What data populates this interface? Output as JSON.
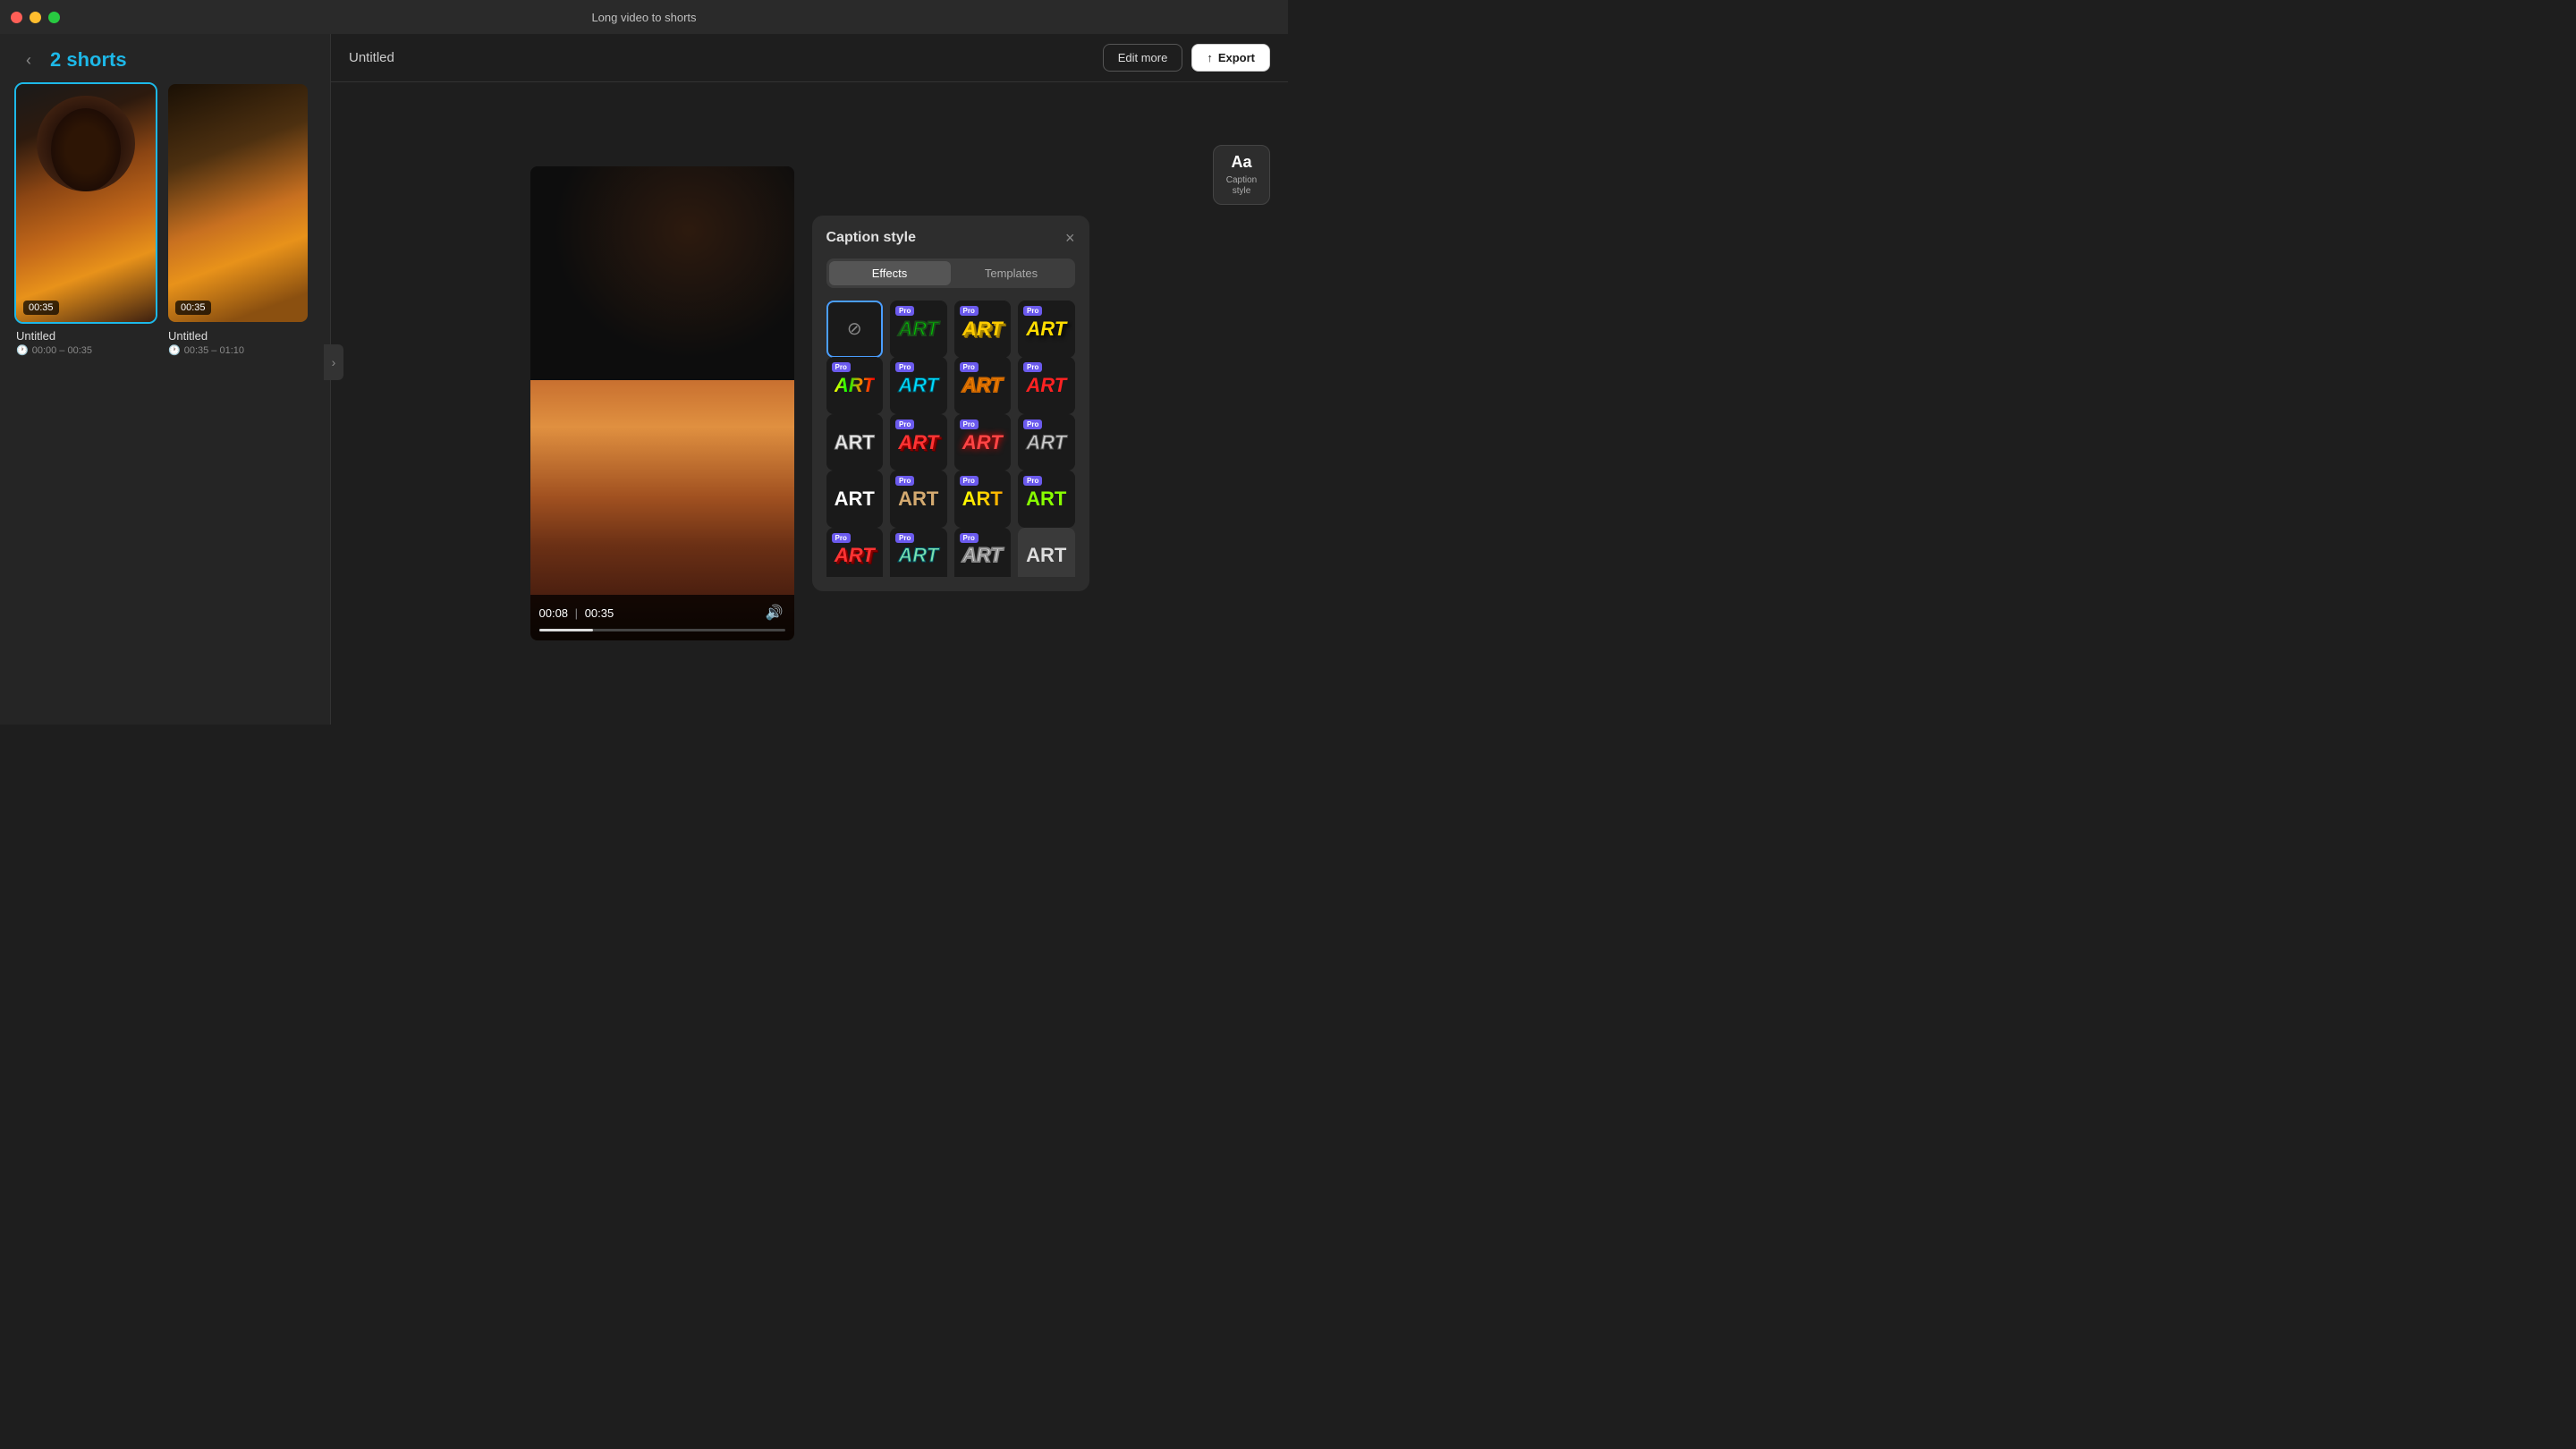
{
  "window": {
    "title": "Long video to shorts"
  },
  "titlebar": {
    "close_label": "close",
    "minimize_label": "minimize",
    "maximize_label": "maximize"
  },
  "left_panel": {
    "back_label": "‹",
    "title": "2 shorts",
    "shorts": [
      {
        "name": "Untitled",
        "duration": "00:35",
        "time_range": "00:00 – 00:35",
        "selected": true
      },
      {
        "name": "Untitled",
        "duration": "00:35",
        "time_range": "00:35 – 01:10",
        "selected": false
      }
    ]
  },
  "top_bar": {
    "doc_title": "Untitled",
    "edit_more_label": "Edit more",
    "export_label": "Export",
    "export_icon": "↑"
  },
  "video": {
    "current_time": "00:08",
    "total_time": "00:35",
    "separator": "|",
    "progress_percent": 22
  },
  "caption_panel": {
    "title": "Caption style",
    "close_label": "×",
    "tabs": [
      {
        "id": "effects",
        "label": "Effects",
        "active": true
      },
      {
        "id": "templates",
        "label": "Templates",
        "active": false
      }
    ],
    "styles": [
      {
        "id": "none",
        "type": "none",
        "bg": "dark",
        "selected": true,
        "pro": false
      },
      {
        "id": "green-italic",
        "text": "ART",
        "type": "green-outline",
        "bg": "dark",
        "selected": false,
        "pro": true
      },
      {
        "id": "yellow-3d",
        "text": "ART",
        "type": "yellow-3d",
        "bg": "dark",
        "selected": false,
        "pro": true
      },
      {
        "id": "yellow-shadow",
        "text": "ART",
        "type": "yellow-shadow",
        "bg": "dark",
        "selected": false,
        "pro": true
      },
      {
        "id": "multicolor",
        "text": "ART",
        "type": "multicolor",
        "bg": "dark",
        "selected": false,
        "pro": true
      },
      {
        "id": "cyan",
        "text": "ART",
        "type": "cyan",
        "bg": "dark",
        "selected": false,
        "pro": true
      },
      {
        "id": "orange",
        "text": "ART",
        "type": "orange-outline",
        "bg": "dark",
        "selected": false,
        "pro": true
      },
      {
        "id": "red-bright",
        "text": "ART",
        "type": "red-bright",
        "bg": "dark",
        "selected": false,
        "pro": true
      },
      {
        "id": "white-outline",
        "text": "ART",
        "type": "white-outline",
        "bg": "dark",
        "selected": false,
        "pro": false
      },
      {
        "id": "red-3d",
        "text": "ART",
        "type": "red-3d",
        "bg": "dark",
        "selected": false,
        "pro": true
      },
      {
        "id": "red-shadow",
        "text": "ART",
        "type": "red-shadow",
        "bg": "dark",
        "selected": false,
        "pro": true
      },
      {
        "id": "gray-outline",
        "text": "ART",
        "type": "gray-outline",
        "bg": "dark",
        "selected": false,
        "pro": true
      },
      {
        "id": "white-clean",
        "text": "ART",
        "type": "white-clean",
        "bg": "dark",
        "selected": false,
        "pro": false
      },
      {
        "id": "tan",
        "text": "ART",
        "type": "tan",
        "bg": "dark",
        "selected": false,
        "pro": true
      },
      {
        "id": "yellow-grad",
        "text": "ART",
        "type": "yellow-gradient",
        "bg": "dark",
        "selected": false,
        "pro": true
      },
      {
        "id": "lime",
        "text": "ART",
        "type": "lime",
        "bg": "dark",
        "selected": false,
        "pro": true
      },
      {
        "id": "row5a",
        "text": "ART",
        "type": "red-3d",
        "bg": "dark",
        "selected": false,
        "pro": true
      },
      {
        "id": "row5b",
        "text": "ART",
        "type": "cyan",
        "bg": "dark",
        "selected": false,
        "pro": true
      },
      {
        "id": "row5c",
        "text": "ART",
        "type": "gray-outline",
        "bg": "dark",
        "selected": false,
        "pro": true
      },
      {
        "id": "row5d",
        "text": "ART",
        "type": "white-clean",
        "bg": "light",
        "selected": false,
        "pro": false
      }
    ]
  },
  "caption_style_btn": {
    "aa_text": "Aa",
    "label": "Caption\nstyle"
  }
}
